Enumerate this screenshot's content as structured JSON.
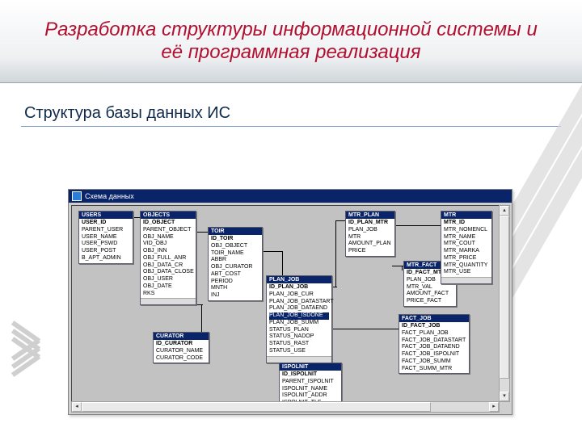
{
  "title_line1": "Разработка структуры информационной системы и",
  "title_line2": "её программная реализация",
  "subtitle": "Структура базы данных ИС",
  "window_caption": "Схема данных",
  "tables": {
    "users": {
      "name": "USERS",
      "cols": [
        "USER_ID",
        "PARENT_USER",
        "USER_NAME",
        "USER_PSWD",
        "USER_POST",
        "B_APT_ADMIN"
      ]
    },
    "objects": {
      "name": "OBJECTS",
      "cols": [
        "ID_OBJECT",
        "PARENT_OBJECT",
        "OBJ_NAME",
        "VID_OBJ",
        "OBJ_INN",
        "OBJ_FULL_ANR",
        "OBJ_DATA_CR",
        "OBJ_DATA_CLOSE",
        "OBJ_USER",
        "OBJ_DATE",
        "RKS"
      ]
    },
    "curator": {
      "name": "CURATOR",
      "cols": [
        "ID_CURATOR",
        "CURATOR_NAME",
        "CURATOR_CODE"
      ]
    },
    "toir": {
      "name": "TOIR",
      "cols": [
        "ID_TOIR",
        "OBJ_OBJECT",
        "TOIR_NAME",
        "ABBR",
        "OBJ_CURATOR",
        "ABT_COST",
        "PERIOD",
        "MNTH",
        "INJ"
      ]
    },
    "plan": {
      "name": "PLAN_JOB",
      "cols": [
        "ID_PLAN_JOB",
        "PLAN_JOB_CUR",
        "PLAN_JOB_DATASTART",
        "PLAN_JOB_DATAEND",
        "PLAN_JOB_ISDONE",
        "PLAN_JOB_SUMM",
        "STATUS_PLAN",
        "STATUS_NADOP",
        "STATUS_RAST",
        "STATUS_USE"
      ]
    },
    "ispolnit": {
      "name": "ISPOLNIT",
      "cols": [
        "ID_ISPOLNIT",
        "PARENT_ISPOLNIT",
        "ISPOLNIT_NAME",
        "ISPOLNIT_ADDR",
        "ISPOLNIT_TLF"
      ]
    },
    "mtr_plan": {
      "name": "MTR_PLAN",
      "cols": [
        "ID_PLAN_MTR",
        "PLAN_JOB",
        "MTR",
        "AMOUNT_PLAN",
        "PRICE"
      ]
    },
    "mtr_fact": {
      "name": "MTR_FACT",
      "cols": [
        "ID_FACT_MTR",
        "PLAN_JOB",
        "MTR_VAL",
        "AMOUNT_FACT",
        "PRICE_FACT"
      ]
    },
    "fact_job": {
      "name": "FACT_JOB",
      "cols": [
        "ID_FACT_JOB",
        "FACT_PLAN_JOB",
        "FACT_JOB_DATASTART",
        "FACT_JOB_DATAEND",
        "FACT_JOB_ISPOLNIT",
        "FACT_JOB_SUMM",
        "FACT_SUMM_MTR"
      ]
    },
    "mtr": {
      "name": "MTR",
      "cols": [
        "MTR_ID",
        "MTR_NOMENCL",
        "MTR_NAME",
        "MTR_COUT",
        "MTR_MARKA",
        "MTR_PRICE",
        "MTR_QUANTITY",
        "MTR_USE"
      ]
    }
  }
}
